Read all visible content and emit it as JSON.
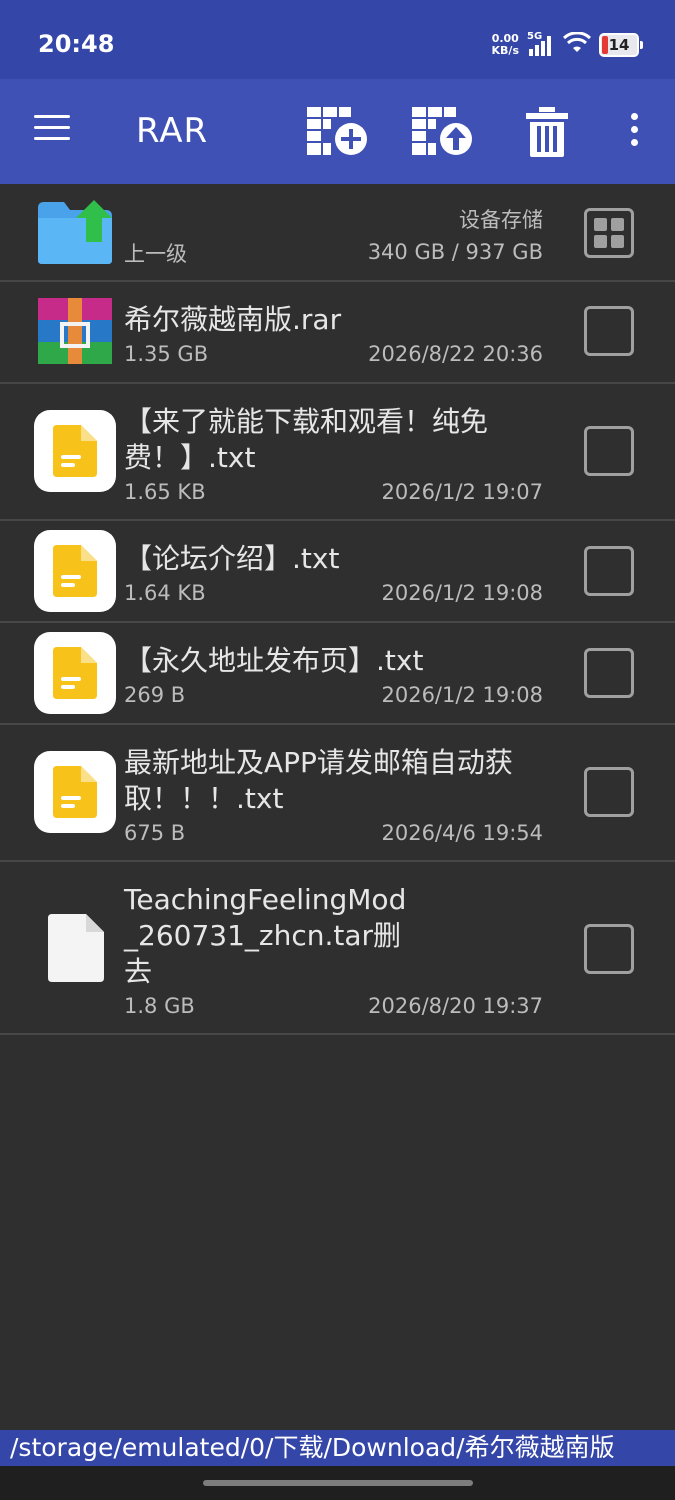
{
  "status_bar": {
    "time": "20:48",
    "net_speed_value": "0.00",
    "net_speed_unit": "KB/s",
    "network": "5G",
    "battery": "14"
  },
  "toolbar": {
    "title": "RAR",
    "icons": [
      "menu-icon",
      "add-to-archive-icon",
      "extract-icon",
      "delete-icon",
      "more-vert-icon"
    ]
  },
  "parent_row": {
    "label": "上一级",
    "storage_label": "设备存储",
    "storage_usage": "340 GB / 937 GB"
  },
  "files": [
    {
      "name": "希尔薇越南版.rar",
      "size": "1.35 GB",
      "date": "2026/8/22 20:36",
      "type": "rar"
    },
    {
      "name": "【来了就能下载和观看！纯免费！】.txt",
      "name_lines": [
        "【来了就能下载和观看！纯免",
        "费！】.txt"
      ],
      "size": "1.65 KB",
      "date": "2026/1/2 19:07",
      "type": "txt"
    },
    {
      "name": "【论坛介绍】.txt",
      "size": "1.64 KB",
      "date": "2026/1/2 19:08",
      "type": "txt"
    },
    {
      "name": "【永久地址发布页】.txt",
      "size": "269 B",
      "date": "2026/1/2 19:08",
      "type": "txt"
    },
    {
      "name": "最新地址及APP请发邮箱自动获取！！！.txt",
      "name_lines": [
        "最新地址及APP请发邮箱自动获",
        "取！！！.txt"
      ],
      "size": "675 B",
      "date": "2026/4/6 19:54",
      "type": "txt"
    },
    {
      "name": "TeachingFeelingMod_260731_zhcn.tar删去",
      "name_lines": [
        "TeachingFeelingMod",
        "_260731_zhcn.tar删",
        "去"
      ],
      "size": "1.8 GB",
      "date": "2026/8/20 19:37",
      "type": "generic"
    }
  ],
  "path": "/storage/emulated/0/下载/Download/希尔薇越南版",
  "colors": {
    "app_bar": "#3f51b5",
    "status_bar": "#3446a8",
    "background": "#2f2f2f",
    "txt_icon": "#f7c21a"
  }
}
